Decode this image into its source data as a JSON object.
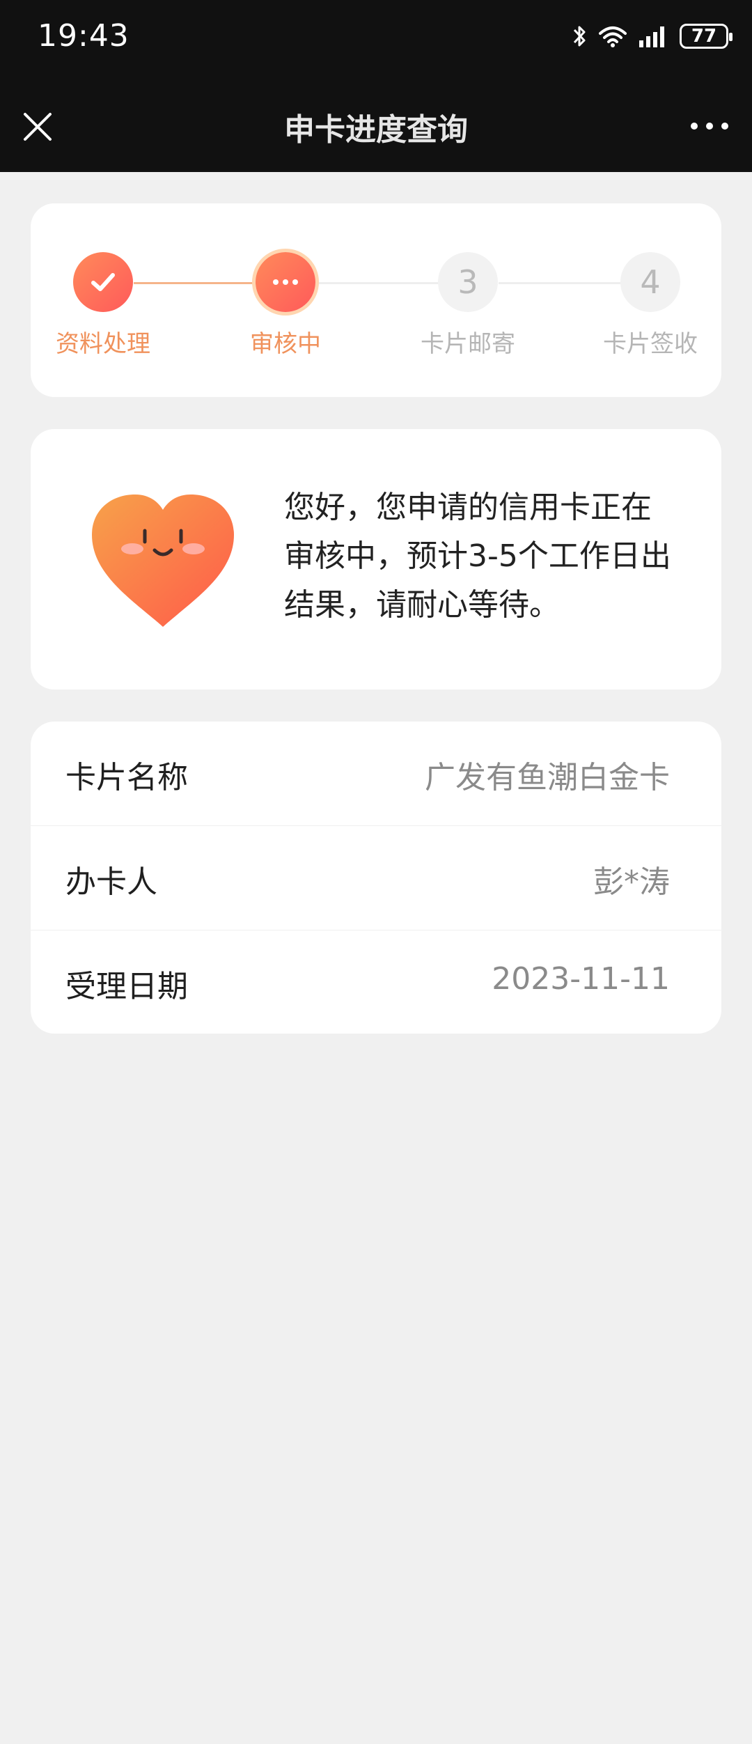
{
  "status_bar": {
    "time": "19:43",
    "battery": "77"
  },
  "nav": {
    "title": "申卡进度查询"
  },
  "steps": [
    {
      "label": "资料处理",
      "state": "done"
    },
    {
      "label": "审核中",
      "state": "current"
    },
    {
      "label": "卡片邮寄",
      "number": "3",
      "state": "pending"
    },
    {
      "label": "卡片签收",
      "number": "4",
      "state": "pending"
    }
  ],
  "message": {
    "text": "您好，您申请的信用卡正在审核中，预计3-5个工作日出结果，请耐心等待。"
  },
  "info": [
    {
      "key": "卡片名称",
      "value": "广发有鱼潮白金卡"
    },
    {
      "key": "办卡人",
      "value": "彭*涛"
    },
    {
      "key": "受理日期",
      "value": "2023-11-11"
    }
  ],
  "colors": {
    "accent": "#f0925c",
    "nav_bg": "#111111",
    "page_bg": "#f0f0f0"
  }
}
